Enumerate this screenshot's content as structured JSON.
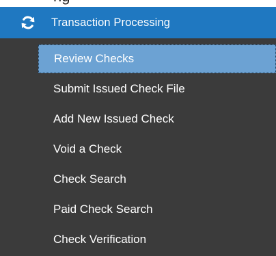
{
  "top_peek": "ng",
  "header": {
    "icon": "refresh-icon",
    "label": "Transaction Processing",
    "color": "#1f78c1"
  },
  "menu": {
    "background": "#3b3b3b",
    "active_color": "#6ca2d3",
    "items": [
      {
        "label": "Review Checks",
        "active": true
      },
      {
        "label": "Submit Issued Check File",
        "active": false
      },
      {
        "label": "Add New Issued Check",
        "active": false
      },
      {
        "label": "Void a Check",
        "active": false
      },
      {
        "label": "Check Search",
        "active": false
      },
      {
        "label": "Paid Check Search",
        "active": false
      },
      {
        "label": "Check Verification",
        "active": false
      }
    ]
  }
}
